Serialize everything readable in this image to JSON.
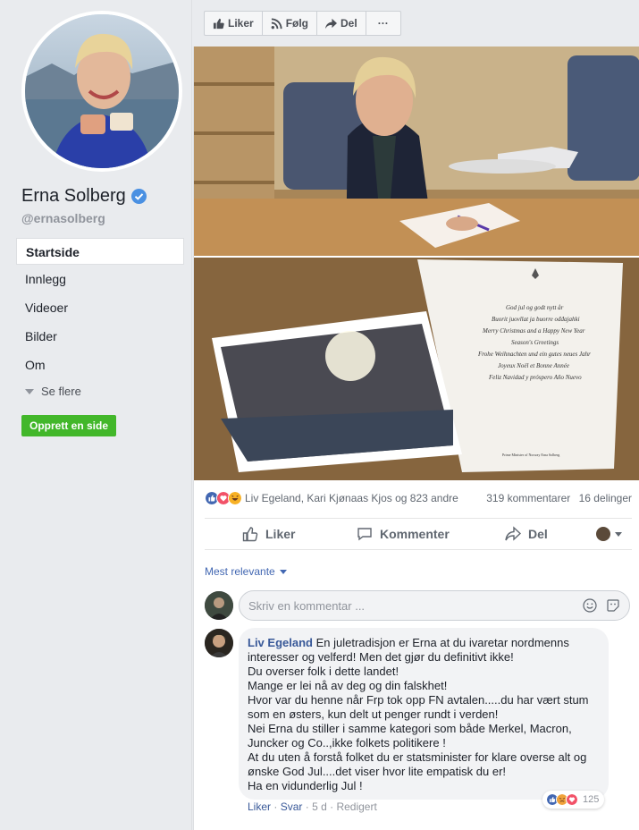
{
  "sidebar": {
    "page_name": "Erna Solberg",
    "handle": "@ernasolberg",
    "nav": [
      {
        "label": "Startside",
        "active": true
      },
      {
        "label": "Innlegg"
      },
      {
        "label": "Videoer"
      },
      {
        "label": "Bilder"
      },
      {
        "label": "Om"
      }
    ],
    "see_more": "Se flere",
    "create_page": "Opprett en side"
  },
  "top_actions": {
    "like": "Liker",
    "follow": "Følg",
    "share": "Del",
    "more": "···"
  },
  "post": {
    "card": {
      "greetings": [
        "God jul og godt nytt år",
        "Buorit juovllat ja buorre ođđajahki",
        "Merry Christmas and a Happy New Year",
        "Season's Greetings",
        "Frohe Weihnachten und ein gutes neues Jahr",
        "Joyeux Noël et Bonne Année",
        "Feliz Navidad y próspero Año Nuevo"
      ],
      "signature": "Prime Minister of Norway Erna Solberg"
    },
    "reactions": {
      "names": "Liv Egeland, Kari Kjønaas Kjos og 823 andre",
      "comments": "319 kommentarer",
      "shares": "16 delinger"
    },
    "actions": {
      "like": "Liker",
      "comment": "Kommenter",
      "share": "Del"
    },
    "sort_label": "Mest relevante",
    "comment_placeholder": "Skriv en kommentar ...",
    "comment": {
      "author": "Liv Egeland",
      "lines": [
        "En juletradisjon er Erna at du ivaretar nordmenns",
        "interesser og velferd! Men det gjør du definitivt ikke!",
        "Du overser folk i dette landet!",
        "Mange er lei nå av deg og din falskhet!",
        "Hvor var du henne når Frp tok opp FN avtalen.....du har vært stum",
        "som en østers, kun delt ut penger rundt i verden!",
        "Nei Erna du stiller i samme kategori som både Merkel, Macron,",
        "Juncker og Co..,ikke folkets politikere !",
        "At du uten å forstå folket du er statsminister for klare overse alt og",
        "ønske God Jul....det viser hvor lite empatisk du er!",
        "Ha en vidunderlig Jul !"
      ],
      "reaction_count": "125",
      "meta": {
        "like": "Liker",
        "reply": "Svar",
        "time": "5 d",
        "edited": "Redigert"
      }
    }
  },
  "colors": {
    "brand_blue": "#4267b2",
    "link_blue": "#385898",
    "green": "#42b72a",
    "bg": "#e9ebee"
  }
}
